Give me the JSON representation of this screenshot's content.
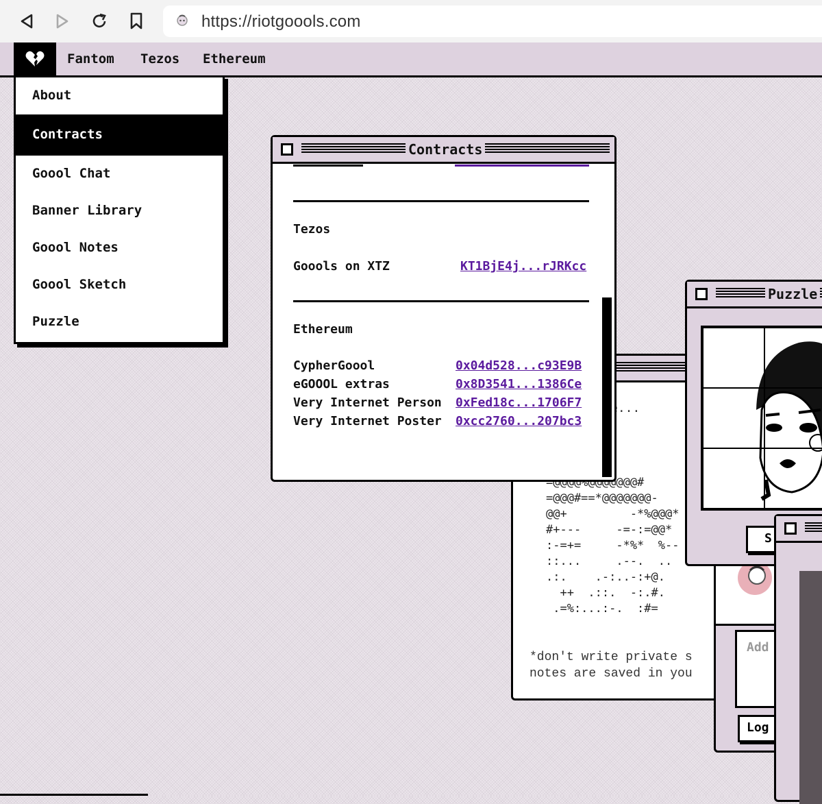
{
  "browser": {
    "url": "https://riotgoools.com",
    "icons": [
      "back-icon",
      "forward-icon",
      "reload-icon",
      "bookmark-icon",
      "site-favicon-icon"
    ]
  },
  "menubar": {
    "logo_icon": "broken-heart-icon",
    "items": [
      "Fantom",
      "Tezos",
      "Ethereum"
    ]
  },
  "dropdown": {
    "items": [
      {
        "label": "About",
        "active": false
      },
      {
        "label": "Contracts",
        "active": true
      },
      {
        "label": "Goool Chat",
        "active": false
      },
      {
        "label": "Banner Library",
        "active": false
      },
      {
        "label": "Goool Notes",
        "active": false
      },
      {
        "label": "Goool Sketch",
        "active": false
      },
      {
        "label": "Puzzle",
        "active": false
      }
    ]
  },
  "contracts_window": {
    "title": "Contracts",
    "sections": [
      {
        "heading": "Tezos",
        "entries": [
          {
            "name": "Goools on XTZ",
            "address": "KT1BjE4j...rJRKcc"
          }
        ]
      },
      {
        "heading": "Ethereum",
        "entries": [
          {
            "name": "CypherGoool",
            "address": "0x04d528...c93E9B"
          },
          {
            "name": "eGOOOL extras",
            "address": "0x8D3541...1386Ce"
          },
          {
            "name": "Very Internet Person",
            "address": "0xFed18c...1706F7"
          },
          {
            "name": "Very Internet Poster",
            "address": "0xcc2760...207bc3"
          }
        ]
      }
    ]
  },
  "notes_window": {
    "partial_text": "e...",
    "ascii_art": " :.\n@@@@*-\n=@@@@%@@@@@@@#\n=@@@#==*@@@@@@@-\n@@+         -*%@@@*\n#+---     -=-:=@@*\n:-=+=     -*%*  %--\n::...     .--.  ..\n.:.    .-:..-:+@.\n  ++  .::.  -:.#.\n .=%:...:-.  :#=",
    "warning_line1": "*don't write private s",
    "warning_line2": "notes are saved in you"
  },
  "puzzle_window": {
    "title": "Puzzle",
    "button_partial": "S"
  },
  "chat_window": {
    "input_placeholder_partial": "Add",
    "button_partial": "Log"
  },
  "colors": {
    "menubar": "#ded2df",
    "link": "#5b1a9e",
    "active": "#000000",
    "desktop": "#ece6ec"
  }
}
